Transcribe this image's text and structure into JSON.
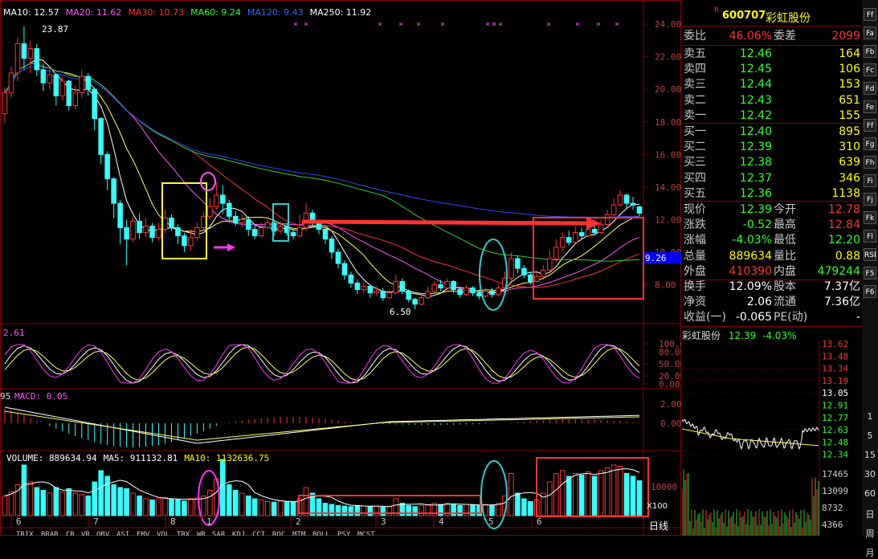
{
  "ma_legend": [
    {
      "label": "MA10: 12.57",
      "color": "#ffffff"
    },
    {
      "label": "MA20: 11.62",
      "color": "#ff55ff"
    },
    {
      "label": "MA30: 10.73",
      "color": "#ff3030"
    },
    {
      "label": "MA60: 9.24",
      "color": "#33ff33"
    },
    {
      "label": "MA120: 9.43",
      "color": "#3366ff"
    },
    {
      "label": "MA250: 11.92",
      "color": "#ffffff"
    }
  ],
  "price_high_label": "23.87",
  "price_low_label": "6.50",
  "price_marker": "9.26",
  "right_axis_price": [
    "24.00",
    "22.00",
    "20.00",
    "18.00",
    "16.00",
    "14.00",
    "12.00",
    "10.00",
    "8.00"
  ],
  "kdj_label": "2.61",
  "kdj_axis": [
    "100.00",
    "80.00",
    "50.00",
    "20.00",
    "0.00"
  ],
  "macd_label_prefix": "95",
  "macd_label": "MACD: 0.05",
  "macd_axis": [
    "2.00",
    "0.00"
  ],
  "volume_legend": [
    {
      "label": "VOLUME: 889634.94",
      "color": "#ffffff"
    },
    {
      "label": "MA5: 911132.81",
      "color": "#ffffff"
    },
    {
      "label": "MA10: 1132636.75",
      "color": "#ffff00"
    }
  ],
  "volume_axis": [
    "10000"
  ],
  "volume_unit": "X100",
  "daily_label": "日线",
  "month_labels": [
    "6",
    "7",
    "8",
    "1",
    "2",
    "3",
    "4",
    "5",
    "6"
  ],
  "indicator_tabs": [
    "TRIX",
    "BRAR",
    "CR",
    "VR",
    "OBV",
    "ASI",
    "EMV",
    "VOL",
    "TRX",
    "WR",
    "SAR",
    "KDJ",
    "CCI",
    "ROC",
    "MTM",
    "BOLL",
    "PSY",
    "MCST"
  ],
  "quote": {
    "code": "600707",
    "name": "彩虹股份",
    "r_mark": "R",
    "webi_label": "委比",
    "webi_value": "46.06%",
    "weicha_label": "委差",
    "weicha_value": "2099",
    "asks": [
      {
        "label": "卖五",
        "price": "12.46",
        "vol": "164"
      },
      {
        "label": "卖四",
        "price": "12.45",
        "vol": "106"
      },
      {
        "label": "卖三",
        "price": "12.44",
        "vol": "153"
      },
      {
        "label": "卖二",
        "price": "12.43",
        "vol": "651"
      },
      {
        "label": "卖一",
        "price": "12.42",
        "vol": "155"
      }
    ],
    "bids": [
      {
        "label": "买一",
        "price": "12.40",
        "vol": "895"
      },
      {
        "label": "买二",
        "price": "12.39",
        "vol": "310"
      },
      {
        "label": "买三",
        "price": "12.38",
        "vol": "639"
      },
      {
        "label": "买四",
        "price": "12.37",
        "vol": "346"
      },
      {
        "label": "买五",
        "price": "12.36",
        "vol": "1138"
      }
    ],
    "stats": [
      {
        "l1": "现价",
        "v1": "12.39",
        "c1": "#33ff33",
        "l2": "今开",
        "v2": "12.78",
        "c2": "#ff3333"
      },
      {
        "l1": "涨跌",
        "v1": "-0.52",
        "c1": "#33ff33",
        "l2": "最高",
        "v2": "12.84",
        "c2": "#ff3333"
      },
      {
        "l1": "涨幅",
        "v1": "-4.03%",
        "c1": "#33ff33",
        "l2": "最低",
        "v2": "12.20",
        "c2": "#33ff33"
      },
      {
        "l1": "总量",
        "v1": "889634",
        "c1": "#ffff00",
        "l2": "量比",
        "v2": "0.88",
        "c2": "#ffff00"
      },
      {
        "l1": "外盘",
        "v1": "410390",
        "c1": "#ff3333",
        "l2": "内盘",
        "v2": "479244",
        "c2": "#33ff33"
      }
    ],
    "stats2": [
      {
        "l1": "换手",
        "v1": "12.09%",
        "l2": "股本",
        "v2": "7.37亿"
      },
      {
        "l1": "净资",
        "v1": "2.06",
        "l2": "流通",
        "v2": "7.36亿"
      },
      {
        "l1": "收益(一)",
        "v1": "-0.065",
        "l2": "PE(动)",
        "v2": "-"
      }
    ],
    "mini_title": "彩虹股份",
    "mini_price": "12.39",
    "mini_change": "-4.03%",
    "mini_axis": [
      "13.62",
      "13.48",
      "13.34",
      "13.19",
      "13.05",
      "12.91",
      "12.77",
      "12.63",
      "12.48",
      "12.34"
    ],
    "mini_vol_axis": [
      "17465",
      "13099",
      "8732",
      "4366"
    ]
  },
  "toolbar": {
    "buttons": [
      "Ff",
      "Fa",
      "Fb",
      "Fc",
      "Fd",
      "Fe",
      "Ff",
      "Fg",
      "Fh",
      "Fi",
      "Fj",
      "Fk",
      "Fl",
      "RSI",
      "F5",
      "F6"
    ],
    "numbers": [
      "1",
      "5",
      "15",
      "30",
      "60",
      "日",
      "周",
      "月"
    ]
  },
  "chart_data": {
    "type": "candlestick",
    "title": "",
    "y_range": [
      6.0,
      24.5
    ],
    "candles": [
      [
        18.5,
        19.8,
        17.9,
        20.1
      ],
      [
        19.8,
        21.0,
        19.5,
        21.4
      ],
      [
        21.0,
        22.8,
        20.5,
        23.2
      ],
      [
        22.8,
        21.9,
        21.2,
        23.87
      ],
      [
        21.9,
        22.5,
        21.0,
        23.0
      ],
      [
        22.5,
        21.2,
        20.8,
        22.8
      ],
      [
        21.2,
        20.4,
        19.9,
        21.6
      ],
      [
        20.4,
        20.9,
        20.0,
        21.3
      ],
      [
        20.9,
        19.6,
        19.0,
        21.0
      ],
      [
        19.6,
        20.5,
        19.3,
        20.8
      ],
      [
        20.5,
        19.0,
        18.7,
        20.6
      ],
      [
        19.0,
        19.8,
        18.8,
        20.2
      ],
      [
        19.8,
        20.8,
        19.5,
        21.2
      ],
      [
        20.8,
        20.0,
        19.6,
        21.0
      ],
      [
        20.0,
        18.2,
        17.5,
        20.1
      ],
      [
        18.2,
        16.0,
        15.4,
        18.3
      ],
      [
        16.0,
        14.5,
        13.8,
        16.2
      ],
      [
        14.5,
        13.0,
        12.1,
        14.6
      ],
      [
        13.0,
        11.5,
        10.5,
        13.2
      ],
      [
        11.5,
        10.8,
        9.2,
        12.0
      ],
      [
        10.8,
        11.9,
        10.6,
        12.2
      ],
      [
        11.9,
        11.2,
        10.8,
        12.4
      ],
      [
        11.2,
        11.6,
        10.9,
        12.1
      ],
      [
        11.6,
        10.9,
        10.6,
        11.8
      ],
      [
        10.9,
        11.4,
        10.7,
        11.8
      ],
      [
        11.4,
        12.1,
        11.2,
        12.6
      ],
      [
        12.1,
        11.5,
        11.3,
        12.3
      ],
      [
        11.5,
        11.0,
        10.5,
        11.7
      ],
      [
        11.0,
        10.4,
        10.0,
        11.2
      ],
      [
        10.4,
        10.9,
        10.1,
        11.4
      ],
      [
        10.9,
        11.5,
        10.7,
        11.8
      ],
      [
        11.5,
        12.2,
        11.3,
        12.5
      ],
      [
        12.2,
        12.8,
        12.0,
        13.3
      ],
      [
        12.8,
        13.5,
        12.6,
        14.3
      ],
      [
        13.5,
        13.0,
        12.4,
        14.1
      ],
      [
        13.0,
        12.2,
        11.8,
        13.2
      ],
      [
        12.2,
        11.8,
        11.6,
        12.5
      ],
      [
        11.8,
        12.0,
        11.5,
        12.3
      ],
      [
        12.0,
        11.4,
        11.0,
        12.2
      ],
      [
        11.4,
        11.0,
        10.8,
        11.7
      ],
      [
        11.0,
        11.5,
        10.9,
        11.8
      ],
      [
        11.5,
        11.8,
        11.4,
        12.0
      ],
      [
        11.8,
        11.3,
        11.0,
        12.0
      ],
      [
        11.3,
        11.6,
        11.1,
        11.9
      ],
      [
        11.6,
        11.2,
        11.0,
        11.8
      ],
      [
        11.2,
        11.0,
        10.8,
        11.4
      ],
      [
        11.0,
        11.5,
        10.9,
        12.3
      ],
      [
        11.5,
        12.4,
        11.3,
        13.0
      ],
      [
        12.4,
        11.9,
        11.6,
        12.6
      ],
      [
        11.9,
        11.4,
        11.1,
        12.0
      ],
      [
        11.4,
        10.8,
        10.5,
        11.5
      ],
      [
        10.8,
        10.0,
        9.6,
        11.0
      ],
      [
        10.0,
        9.3,
        9.0,
        10.2
      ],
      [
        9.3,
        8.6,
        8.3,
        9.5
      ],
      [
        8.6,
        8.1,
        7.8,
        8.8
      ],
      [
        8.1,
        7.7,
        7.4,
        8.3
      ],
      [
        7.7,
        7.9,
        7.5,
        8.2
      ],
      [
        7.9,
        7.5,
        7.2,
        8.0
      ],
      [
        7.5,
        7.6,
        7.3,
        7.9
      ],
      [
        7.6,
        7.2,
        7.0,
        7.8
      ],
      [
        7.2,
        7.5,
        7.1,
        7.7
      ],
      [
        7.5,
        8.2,
        7.4,
        8.6
      ],
      [
        8.2,
        7.6,
        7.4,
        8.4
      ],
      [
        7.6,
        7.1,
        6.9,
        7.7
      ],
      [
        7.1,
        6.8,
        6.5,
        7.2
      ],
      [
        6.8,
        7.2,
        6.7,
        7.4
      ],
      [
        7.2,
        7.6,
        7.1,
        7.9
      ],
      [
        7.6,
        8.0,
        7.5,
        8.2
      ],
      [
        8.0,
        7.8,
        7.6,
        8.3
      ],
      [
        7.8,
        8.2,
        7.7,
        8.4
      ],
      [
        8.2,
        7.7,
        7.5,
        8.3
      ],
      [
        7.7,
        7.4,
        7.2,
        7.9
      ],
      [
        7.4,
        7.8,
        7.3,
        8.0
      ],
      [
        7.8,
        7.5,
        7.3,
        7.9
      ],
      [
        7.5,
        7.3,
        7.1,
        7.7
      ],
      [
        7.3,
        7.6,
        7.2,
        7.8
      ],
      [
        7.6,
        7.4,
        7.2,
        7.8
      ],
      [
        7.4,
        7.8,
        7.3,
        8.0
      ],
      [
        7.8,
        8.4,
        7.7,
        8.8
      ],
      [
        8.4,
        9.6,
        8.2,
        10.0
      ],
      [
        9.6,
        9.0,
        8.7,
        9.8
      ],
      [
        9.0,
        8.6,
        8.4,
        9.2
      ],
      [
        8.6,
        8.2,
        8.0,
        8.8
      ],
      [
        8.2,
        8.5,
        8.1,
        8.7
      ],
      [
        8.5,
        8.9,
        8.3,
        9.2
      ],
      [
        8.9,
        9.6,
        8.8,
        10.1
      ],
      [
        9.6,
        10.3,
        9.4,
        10.8
      ],
      [
        10.3,
        10.9,
        10.1,
        11.2
      ],
      [
        10.9,
        10.6,
        10.4,
        11.3
      ],
      [
        10.6,
        11.2,
        10.5,
        11.6
      ],
      [
        11.2,
        11.0,
        10.8,
        11.5
      ],
      [
        11.0,
        11.4,
        10.9,
        11.8
      ],
      [
        11.4,
        11.2,
        11.0,
        11.6
      ],
      [
        11.2,
        11.7,
        11.1,
        12.0
      ],
      [
        11.7,
        12.3,
        11.6,
        12.6
      ],
      [
        12.3,
        12.9,
        12.2,
        13.3
      ],
      [
        12.9,
        13.5,
        12.8,
        13.8
      ],
      [
        13.5,
        13.0,
        12.7,
        13.6
      ],
      [
        13.0,
        12.9,
        12.6,
        13.4
      ],
      [
        12.78,
        12.39,
        12.2,
        12.84
      ]
    ],
    "volumes": [
      0.35,
      0.42,
      0.55,
      0.9,
      0.6,
      0.5,
      0.45,
      0.4,
      0.5,
      0.42,
      0.48,
      0.4,
      0.38,
      0.35,
      0.6,
      0.8,
      0.7,
      0.55,
      0.5,
      0.48,
      0.4,
      0.35,
      0.3,
      0.28,
      0.3,
      0.32,
      0.3,
      0.28,
      0.26,
      0.3,
      0.32,
      0.35,
      0.45,
      0.65,
      1.0,
      0.55,
      0.45,
      0.4,
      0.35,
      0.3,
      0.28,
      0.25,
      0.24,
      0.26,
      0.25,
      0.24,
      0.3,
      0.5,
      0.4,
      0.3,
      0.22,
      0.2,
      0.18,
      0.17,
      0.16,
      0.18,
      0.17,
      0.16,
      0.17,
      0.15,
      0.16,
      0.3,
      0.22,
      0.18,
      0.16,
      0.18,
      0.2,
      0.22,
      0.2,
      0.22,
      0.2,
      0.18,
      0.2,
      0.19,
      0.18,
      0.2,
      0.19,
      0.22,
      0.35,
      0.75,
      0.4,
      0.3,
      0.25,
      0.28,
      0.4,
      0.6,
      0.75,
      0.8,
      0.7,
      0.75,
      0.72,
      0.78,
      0.7,
      0.8,
      0.85,
      0.9,
      0.88,
      0.75,
      0.7,
      0.62
    ]
  }
}
